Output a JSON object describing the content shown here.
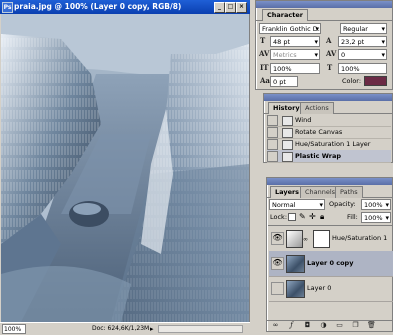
{
  "document": {
    "title": "praia.jpg @ 100% (Layer 0 copy, RGB/8)",
    "zoom": "100%",
    "doc_info": "Doc: 624,6K/1,23M"
  },
  "character": {
    "title": "Character",
    "font_family": "Franklin Gothic D...",
    "font_style": "Regular",
    "font_size": "48 pt",
    "leading": "23,2 pt",
    "kerning": "Metrics",
    "tracking": "0",
    "vertical_scale": "100%",
    "horizontal_scale": "100%",
    "baseline_shift": "0 pt",
    "color_label": "Color:",
    "color_value": "#6b2a45"
  },
  "history": {
    "tabs": [
      "History",
      "Actions"
    ],
    "items": [
      "Wind",
      "Rotate Canvas",
      "Hue/Saturation 1 Layer",
      "Plastic Wrap"
    ],
    "selected": "Plastic Wrap"
  },
  "layers": {
    "tabs": [
      "Layers",
      "Channels",
      "Paths"
    ],
    "blend_mode": "Normal",
    "opacity_label": "Opacity:",
    "opacity": "100%",
    "lock_label": "Lock:",
    "fill_label": "Fill:",
    "fill": "100%",
    "items": [
      {
        "name": "Hue/Saturation 1"
      },
      {
        "name": "Layer 0 copy"
      },
      {
        "name": "Layer 0"
      }
    ],
    "selected": "Layer 0 copy"
  }
}
